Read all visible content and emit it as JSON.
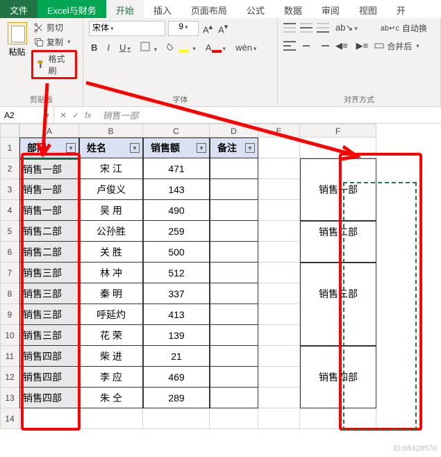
{
  "tabs": {
    "file": "文件",
    "custom": "Excel与财务",
    "home": "开始",
    "insert": "插入",
    "layout": "页面布局",
    "formula": "公式",
    "data": "数据",
    "review": "审阅",
    "view": "视图",
    "dev": "开"
  },
  "clipboard": {
    "paste": "粘贴",
    "cut": "剪切",
    "copy": "复制",
    "format_painter": "格式刷",
    "group": "剪贴板"
  },
  "font": {
    "name": "宋体",
    "size": "9",
    "bold": "B",
    "italic": "I",
    "underline": "U",
    "wen": "wén",
    "group": "字体"
  },
  "align": {
    "wrap": "自动换",
    "merge": "合并后",
    "group": "对齐方式",
    "ab": "ab",
    "arrow": "↘"
  },
  "namebox": "A2",
  "formula_value": "销售一部",
  "fx": "fx",
  "columns": [
    "A",
    "B",
    "C",
    "D",
    "E",
    "F"
  ],
  "headers": {
    "dept": "部门",
    "name": "姓名",
    "sales": "销售额",
    "note": "备注"
  },
  "table": [
    {
      "dept": "销售一部",
      "name": "宋  江",
      "sales": "471"
    },
    {
      "dept": "销售一部",
      "name": "卢俊义",
      "sales": "143"
    },
    {
      "dept": "销售一部",
      "name": "吴  用",
      "sales": "490"
    },
    {
      "dept": "销售二部",
      "name": "公孙胜",
      "sales": "259"
    },
    {
      "dept": "销售二部",
      "name": "关  胜",
      "sales": "500"
    },
    {
      "dept": "销售三部",
      "name": "林  冲",
      "sales": "512"
    },
    {
      "dept": "销售三部",
      "name": "秦  明",
      "sales": "337"
    },
    {
      "dept": "销售三部",
      "name": "呼延灼",
      "sales": "413"
    },
    {
      "dept": "销售三部",
      "name": "花  荣",
      "sales": "139"
    },
    {
      "dept": "销售四部",
      "name": "柴  进",
      "sales": "21"
    },
    {
      "dept": "销售四部",
      "name": "李  应",
      "sales": "469"
    },
    {
      "dept": "销售四部",
      "name": "朱  仝",
      "sales": "289"
    }
  ],
  "colF": [
    "销售一部",
    "销售二部",
    "销售三部",
    "销售四部"
  ],
  "colF_spans": [
    3,
    2,
    4,
    3
  ],
  "watermark": "ID:68428570"
}
